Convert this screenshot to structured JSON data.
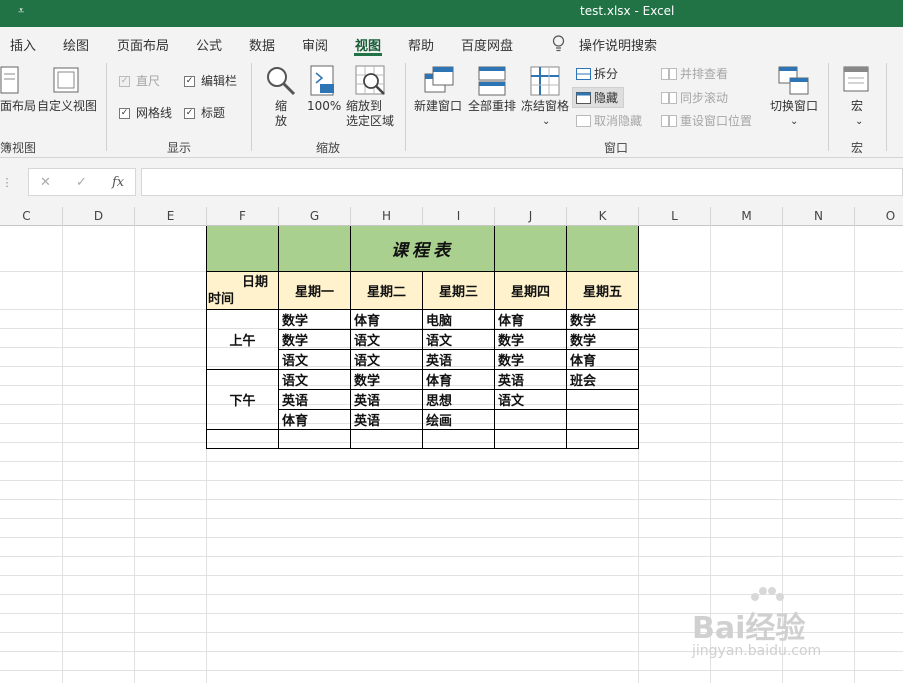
{
  "window": {
    "qat_icon": "quick-access-dropdown-icon",
    "title": "test.xlsx  -  Excel"
  },
  "tabs": [
    {
      "label": "插入"
    },
    {
      "label": "绘图"
    },
    {
      "label": "页面布局"
    },
    {
      "label": "公式"
    },
    {
      "label": "数据"
    },
    {
      "label": "审阅"
    },
    {
      "label": "视图",
      "active": true
    },
    {
      "label": "帮助"
    },
    {
      "label": "百度网盘"
    }
  ],
  "tell_me": "操作说明搜索",
  "ribbon": {
    "workbook_views": {
      "page_layout": "面布局",
      "custom_views": "自定义视图",
      "group": "簿视图"
    },
    "show": {
      "ruler": "直尺",
      "formula_bar": "编辑栏",
      "gridlines": "网格线",
      "headings": "标题",
      "group": "显示"
    },
    "zoom": {
      "zoom": "缩\n放",
      "hundred": "100%",
      "zoom_sel": "缩放到\n选定区域",
      "group": "缩放"
    },
    "window": {
      "new_window": "新建窗口",
      "arrange_all": "全部重排",
      "freeze_panes": "冻结窗格",
      "split": "拆分",
      "hide": "隐藏",
      "unhide": "取消隐藏",
      "side_by_side": "并排查看",
      "sync_scroll": "同步滚动",
      "reset_pos": "重设窗口位置",
      "switch": "切换窗口",
      "group": "窗口"
    },
    "macros": {
      "macros": "宏",
      "group": "宏"
    }
  },
  "formula_bar": {
    "cancel": "✕",
    "enter": "✓",
    "fx": "fx",
    "value": ""
  },
  "columns": [
    "C",
    "D",
    "E",
    "F",
    "G",
    "H",
    "I",
    "J",
    "K",
    "L",
    "M",
    "N",
    "O"
  ],
  "timetable": {
    "title": "课程表",
    "header_date": "日期",
    "header_time": "时间",
    "days": [
      "星期一",
      "星期二",
      "星期三",
      "星期四",
      "星期五"
    ],
    "morning_label": "上午",
    "afternoon_label": "下午",
    "morning": [
      [
        "数学",
        "体育",
        "电脑",
        "体育",
        "数学"
      ],
      [
        "数学",
        "语文",
        "语文",
        "数学",
        "数学"
      ],
      [
        "语文",
        "语文",
        "英语",
        "数学",
        "体育"
      ]
    ],
    "afternoon": [
      [
        "语文",
        "数学",
        "体育",
        "英语",
        "班会"
      ],
      [
        "英语",
        "英语",
        "思想",
        "语文",
        ""
      ],
      [
        "体育",
        "英语",
        "绘画",
        "",
        ""
      ]
    ]
  },
  "watermark": {
    "brand": "Bai经验",
    "url": "jingyan.baidu.com"
  },
  "colors": {
    "excel_green": "#217346",
    "header_green": "#a9d08e",
    "header_cream": "#fff2cc"
  }
}
